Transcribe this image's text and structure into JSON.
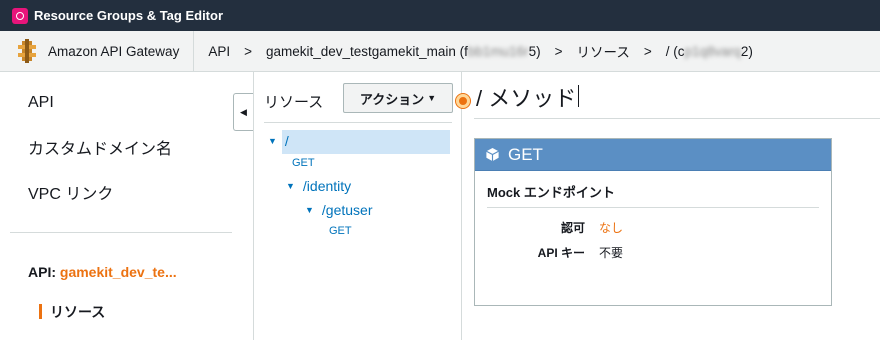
{
  "topbar": {
    "app_label": "Resource Groups & Tag Editor",
    "icon": "resource-groups-icon"
  },
  "breadcrumb": {
    "service": "Amazon API Gateway",
    "service_icon": "api-gateway-icon",
    "items": [
      "API",
      "gamekit_dev_testgamekit_main (fbb1mu16r5)",
      "リソース",
      "/ (cp1q8varq2)"
    ],
    "separator": ">"
  },
  "sidebar": {
    "items": [
      {
        "label": "API"
      },
      {
        "label": "カスタムドメイン名"
      },
      {
        "label": "VPC リンク"
      }
    ],
    "api_prefix": "API:",
    "api_name": "gamekit_dev_te...",
    "current_section": "リソース",
    "collapse_icon": "chevron-left-icon"
  },
  "resources": {
    "title": "リソース",
    "actions_label": "アクション",
    "tree": [
      {
        "path": "/",
        "selected": true
      },
      {
        "method": "GET"
      },
      {
        "path": "/identity"
      },
      {
        "path": "/getuser"
      },
      {
        "method": "GET"
      }
    ]
  },
  "main": {
    "title": "/ メソッド",
    "method_card": {
      "method": "GET",
      "subtitle": "Mock エンドポイント",
      "rows": [
        {
          "label": "認可",
          "value": "なし"
        },
        {
          "label": "API キー",
          "value": "不要"
        }
      ]
    }
  },
  "colors": {
    "topbar": "#232f3e",
    "accent": "#ec7211",
    "link": "#0073bb",
    "card_header": "#5b8fc4",
    "selection": "#cfe5f7"
  }
}
